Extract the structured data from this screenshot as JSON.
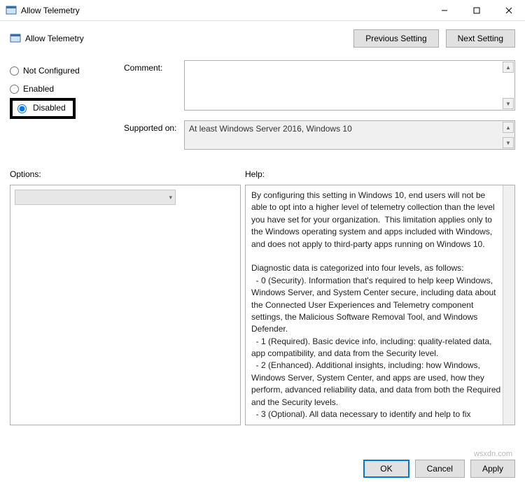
{
  "window": {
    "title": "Allow Telemetry"
  },
  "header": {
    "policy_title": "Allow Telemetry",
    "previous": "Previous Setting",
    "next": "Next Setting"
  },
  "radios": {
    "not_configured": "Not Configured",
    "enabled": "Enabled",
    "disabled": "Disabled",
    "selected": "disabled"
  },
  "labels": {
    "comment": "Comment:",
    "supported": "Supported on:",
    "options": "Options:",
    "help": "Help:"
  },
  "supported_text": "At least Windows Server 2016, Windows 10",
  "help_text": "By configuring this setting in Windows 10, end users will not be able to opt into a higher level of telemetry collection than the level you have set for your organization.  This limitation applies only to the Windows operating system and apps included with Windows, and does not apply to third-party apps running on Windows 10.\n\nDiagnostic data is categorized into four levels, as follows:\n  - 0 (Security). Information that's required to help keep Windows, Windows Server, and System Center secure, including data about the Connected User Experiences and Telemetry component settings, the Malicious Software Removal Tool, and Windows Defender.\n  - 1 (Required). Basic device info, including: quality-related data, app compatibility, and data from the Security level.\n  - 2 (Enhanced). Additional insights, including: how Windows, Windows Server, System Center, and apps are used, how they perform, advanced reliability data, and data from both the Required and the Security levels.\n  - 3 (Optional). All data necessary to identify and help to fix",
  "buttons": {
    "ok": "OK",
    "cancel": "Cancel",
    "apply": "Apply"
  },
  "watermark": "wsxdn.com"
}
